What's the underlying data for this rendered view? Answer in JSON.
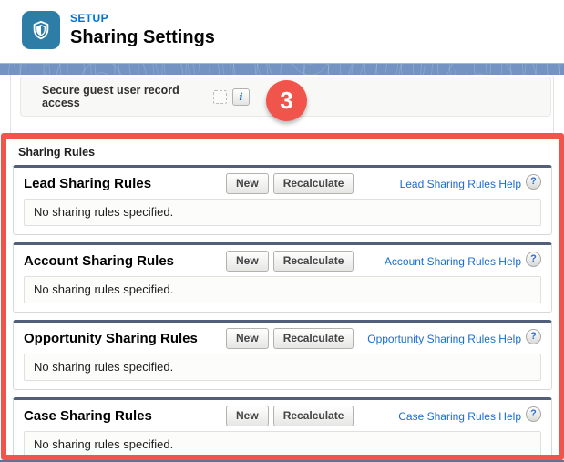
{
  "header": {
    "eyebrow": "SETUP",
    "title": "Sharing Settings"
  },
  "secure_guest": {
    "label": "Secure guest user record access"
  },
  "annotation": {
    "badge": "3"
  },
  "icons": {
    "info": "i",
    "help": "?"
  },
  "sharing_rules": {
    "label": "Sharing Rules",
    "new_label": "New",
    "recalculate_label": "Recalculate",
    "empty_message": "No sharing rules specified.",
    "sections": [
      {
        "title": "Lead Sharing Rules",
        "help_link": "Lead Sharing Rules Help"
      },
      {
        "title": "Account Sharing Rules",
        "help_link": "Account Sharing Rules Help"
      },
      {
        "title": "Opportunity Sharing Rules",
        "help_link": "Opportunity Sharing Rules Help"
      },
      {
        "title": "Case Sharing Rules",
        "help_link": "Case Sharing Rules Help"
      }
    ]
  },
  "colors": {
    "accent_blue": "#0070d2",
    "icon_bg": "#2e7da7",
    "band_blue": "#7493c2",
    "annotation_red": "#f0544a",
    "section_bar": "#525f7a",
    "link_blue": "#1a6dd0"
  }
}
